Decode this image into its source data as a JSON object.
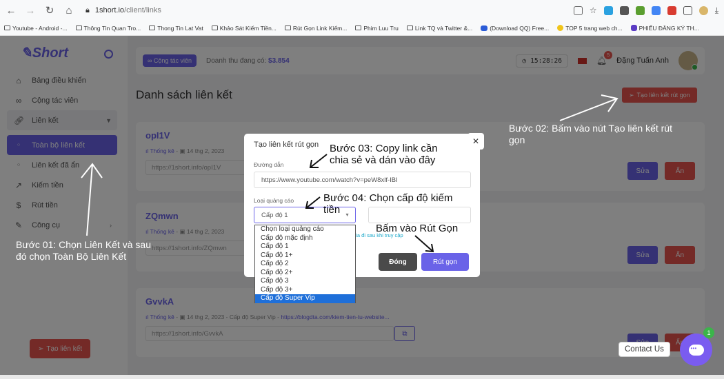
{
  "browser": {
    "url_domain": "1short.io",
    "url_path": "/client/links",
    "bookmarks": [
      "Youtube - Android -...",
      "Thông Tin Quan Tro...",
      "Thong Tin Lat Vat",
      "Khảo Sát Kiếm Tiền...",
      "Rút Gọn Link Kiếm...",
      "Phim Luu Tru",
      "Link TQ và Twitter &...",
      "(Download QQ) Free...",
      "TOP 5 trang web ch...",
      "PHIẾU ĐĂNG KÝ TH..."
    ]
  },
  "sidebar": {
    "logo": "Short",
    "items": [
      {
        "label": "Bảng điều khiển"
      },
      {
        "label": "Cộng tác viên"
      },
      {
        "label": "Liên kết"
      },
      {
        "label": "Toàn bộ liên kết"
      },
      {
        "label": "Liên kết đã ẩn"
      },
      {
        "label": "Kiếm tiền"
      },
      {
        "label": "Rút tiền"
      },
      {
        "label": "Công cụ"
      }
    ],
    "create_button": "Tạo liên kết"
  },
  "topbar": {
    "ctv_button": "Cộng tác viên",
    "revenue_label": "Doanh thu đang có:",
    "revenue_value": "$3.854",
    "clock": "15:28:26",
    "notification_count": "5",
    "user_name": "Đặng Tuấn Anh"
  },
  "main": {
    "title": "Danh sách liên kết",
    "create_button": "Tạo liên kết rút gọn",
    "links": [
      {
        "name": "opI1V",
        "stats": "Thống kê",
        "date": "14 thg 2, 2023",
        "level": "",
        "target": "",
        "short": "https://1short.info/opI1V",
        "edit": "Sửa",
        "hide": "Ẩn"
      },
      {
        "name": "ZQmwn",
        "stats": "Thống kê",
        "date": "14 thg 2, 2023",
        "level": "",
        "target": "",
        "short": "https://1short.info/ZQmwn",
        "edit": "Sửa",
        "hide": "Ẩn"
      },
      {
        "name": "GvvkA",
        "stats": "Thống kê",
        "date": "14 thg 2, 2023",
        "level": "Cấp độ Super Vip",
        "target": "https://blogdta.com/kiem-tien-tu-website...",
        "short": "https://1short.info/GvvkA",
        "edit": "Sửa",
        "hide": "Ẩn"
      }
    ]
  },
  "modal": {
    "title": "Tạo liên kết rút gọn",
    "url_label": "Đường dẫn",
    "url_value": "https://www.youtube.com/watch?v=peW8xlf-IBI",
    "ad_label": "Loại quảng cáo",
    "ad_value": "Cấp độ 1",
    "helper": "xóa đi sau khi truy cập",
    "close_button": "Đóng",
    "submit_button": "Rút gọn",
    "dropdown_options": [
      "Chọn loại quảng cáo",
      "Cấp độ mặc định",
      "Cấp độ 1",
      "Cấp độ 1+",
      "Cấp độ 2",
      "Cấp độ 2+",
      "Cấp độ 3",
      "Cấp độ 3+",
      "Cấp độ Super Vip"
    ]
  },
  "annotations": {
    "step1_line1": "Bước 01: Chọn Liên Kết và sau",
    "step1_line2": "đó chọn Toàn Bộ Liên Kết",
    "step2_line1": "Bước 02: Bấm vào nút Tạo liên kết rút",
    "step2_line2": "gọn",
    "step3_line1": "Bước 03: Copy link cần",
    "step3_line2": "chia sẻ và dán vào đây",
    "step4_line1": "Bước 04: Chọn cấp độ kiếm",
    "step4_line2": "tiền",
    "step5": "Bấm vào Rút Gọn"
  },
  "contact": {
    "label": "Contact Us",
    "badge": "1"
  }
}
